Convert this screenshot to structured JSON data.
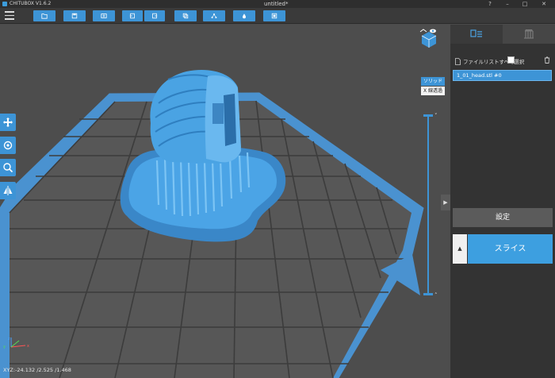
{
  "app": {
    "name": "CHITUBOX V1.6.2",
    "document_title": "untitled*"
  },
  "window_controls": {
    "help": "?",
    "minimize": "–",
    "maximize": "□",
    "close": "✕"
  },
  "toolbar": {
    "buttons": [
      "open-file-icon",
      "save-file-icon",
      "settings-icon",
      "import-icon",
      "export-icon",
      "copy-icon",
      "network-icon",
      "fill-icon",
      "screen-icon"
    ],
    "accent_color": "#3d94d6"
  },
  "left_tools": [
    "move-icon",
    "rotate-icon",
    "scale-icon",
    "mirror-icon"
  ],
  "viewport": {
    "render_modes": {
      "solid": "ソリッド",
      "xray": "X 線透過"
    },
    "active_mode": "solid",
    "coordinates": "XYZ:-24.132 /2.525 /1.468",
    "axis_labels": {
      "x": "x",
      "y": "y",
      "z": "z"
    },
    "slider_arrows": {
      "up": "˅",
      "down": "˄"
    }
  },
  "panel": {
    "tabs": [
      {
        "icon": "file-list-icon",
        "active": true
      },
      {
        "icon": "support-icon",
        "active": false
      }
    ],
    "select_all_label": "ファイルリストすべて選択",
    "files": [
      {
        "name": "1_01_head.stl #0",
        "selected": true
      }
    ],
    "settings_label": "設定",
    "slice_label": "スライス",
    "slice_arrow": "▲",
    "collapse_arrow": "▶"
  }
}
